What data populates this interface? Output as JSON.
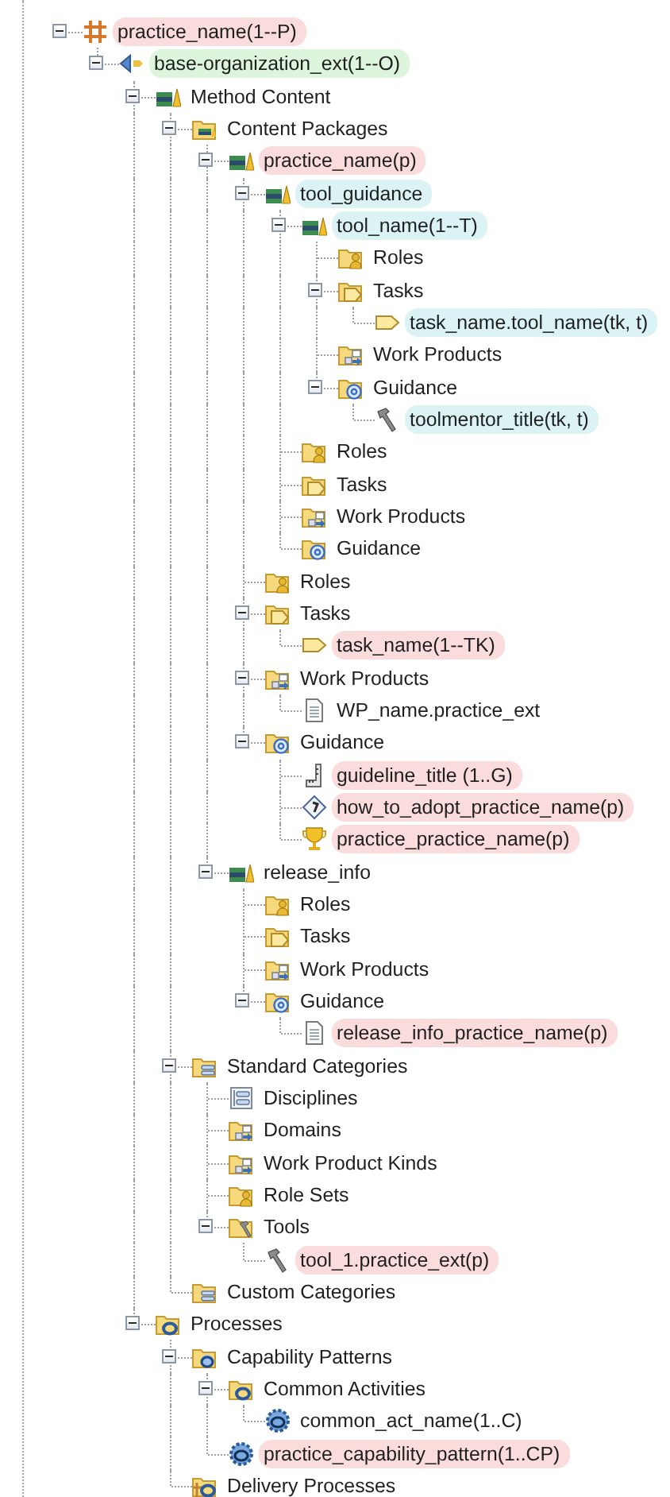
{
  "tree": [
    {
      "label": "practice_name(1--P)",
      "kind": "practice",
      "color": "#fadcdc",
      "expanded": true,
      "children": [
        {
          "label": "base-organization_ext(1--O)",
          "kind": "plugin",
          "color": "#dcf5dc",
          "expanded": true,
          "children": [
            {
              "label": "Method Content",
              "kind": "books",
              "expanded": true,
              "children": [
                {
                  "label": "Content Packages",
                  "kind": "content-folder",
                  "expanded": true,
                  "children": [
                    {
                      "label": "practice_name(p)",
                      "kind": "books",
                      "color": "#fadcdc",
                      "expanded": true,
                      "children": [
                        {
                          "label": "tool_guidance",
                          "kind": "books",
                          "color": "#dcf3f6",
                          "expanded": true,
                          "children": [
                            {
                              "label": "tool_name(1--T)",
                              "kind": "books",
                              "color": "#dcf3f6",
                              "expanded": true,
                              "children": [
                                {
                                  "label": "Roles",
                                  "kind": "folder-roles"
                                },
                                {
                                  "label": "Tasks",
                                  "kind": "folder-tasks",
                                  "expanded": true,
                                  "children": [
                                    {
                                      "label": "task_name.tool_name(tk, t)",
                                      "kind": "task",
                                      "color": "#dcf3f6"
                                    }
                                  ]
                                },
                                {
                                  "label": "Work Products",
                                  "kind": "folder-wp"
                                },
                                {
                                  "label": "Guidance",
                                  "kind": "folder-guidance",
                                  "expanded": true,
                                  "children": [
                                    {
                                      "label": "toolmentor_title(tk, t)",
                                      "kind": "tool",
                                      "color": "#dcf3f6"
                                    }
                                  ]
                                }
                              ]
                            },
                            {
                              "label": "Roles",
                              "kind": "folder-roles"
                            },
                            {
                              "label": "Tasks",
                              "kind": "folder-tasks"
                            },
                            {
                              "label": "Work Products",
                              "kind": "folder-wp"
                            },
                            {
                              "label": "Guidance",
                              "kind": "folder-guidance"
                            }
                          ]
                        },
                        {
                          "label": "Roles",
                          "kind": "folder-roles"
                        },
                        {
                          "label": "Tasks",
                          "kind": "folder-tasks",
                          "expanded": true,
                          "children": [
                            {
                              "label": "task_name(1--TK)",
                              "kind": "task",
                              "color": "#fadcdc"
                            }
                          ]
                        },
                        {
                          "label": "Work Products",
                          "kind": "folder-wp",
                          "expanded": true,
                          "children": [
                            {
                              "label": "WP_name.practice_ext",
                              "kind": "document"
                            }
                          ]
                        },
                        {
                          "label": "Guidance",
                          "kind": "folder-guidance",
                          "expanded": true,
                          "children": [
                            {
                              "label": "guideline_title (1..G)",
                              "kind": "guideline",
                              "color": "#fadcdc"
                            },
                            {
                              "label": "how_to_adopt_practice_name(p)",
                              "kind": "howto",
                              "color": "#fadcdc"
                            },
                            {
                              "label": "practice_practice_name(p)",
                              "kind": "trophy",
                              "color": "#fadcdc"
                            }
                          ]
                        }
                      ]
                    },
                    {
                      "label": "release_info",
                      "kind": "books",
                      "expanded": true,
                      "children": [
                        {
                          "label": "Roles",
                          "kind": "folder-roles"
                        },
                        {
                          "label": "Tasks",
                          "kind": "folder-tasks"
                        },
                        {
                          "label": "Work Products",
                          "kind": "folder-wp"
                        },
                        {
                          "label": "Guidance",
                          "kind": "folder-guidance",
                          "expanded": true,
                          "children": [
                            {
                              "label": "release_info_practice_name(p)",
                              "kind": "document",
                              "color": "#fadcdc"
                            }
                          ]
                        }
                      ]
                    }
                  ]
                },
                {
                  "label": "Standard Categories",
                  "kind": "folder-categories",
                  "expanded": true,
                  "children": [
                    {
                      "label": "Disciplines",
                      "kind": "disciplines"
                    },
                    {
                      "label": "Domains",
                      "kind": "folder-wp"
                    },
                    {
                      "label": "Work Product Kinds",
                      "kind": "folder-wp"
                    },
                    {
                      "label": "Role Sets",
                      "kind": "folder-roles"
                    },
                    {
                      "label": "Tools",
                      "kind": "folder-tools",
                      "expanded": true,
                      "children": [
                        {
                          "label": "tool_1.practice_ext(p)",
                          "kind": "tool",
                          "color": "#fadcdc"
                        }
                      ]
                    }
                  ]
                },
                {
                  "label": "Custom Categories",
                  "kind": "folder-categories"
                }
              ]
            },
            {
              "label": "Processes",
              "kind": "folder-process",
              "expanded": true,
              "children": [
                {
                  "label": "Capability Patterns",
                  "kind": "folder-capability",
                  "expanded": true,
                  "children": [
                    {
                      "label": "Common Activities",
                      "kind": "folder-process",
                      "expanded": true,
                      "children": [
                        {
                          "label": "common_act_name(1..C)",
                          "kind": "capability"
                        }
                      ]
                    },
                    {
                      "label": "practice_capability_pattern(1..CP)",
                      "kind": "capability",
                      "color": "#fadcdc"
                    }
                  ]
                },
                {
                  "label": "Delivery Processes",
                  "kind": "folder-delivery"
                }
              ]
            }
          ]
        }
      ]
    }
  ]
}
